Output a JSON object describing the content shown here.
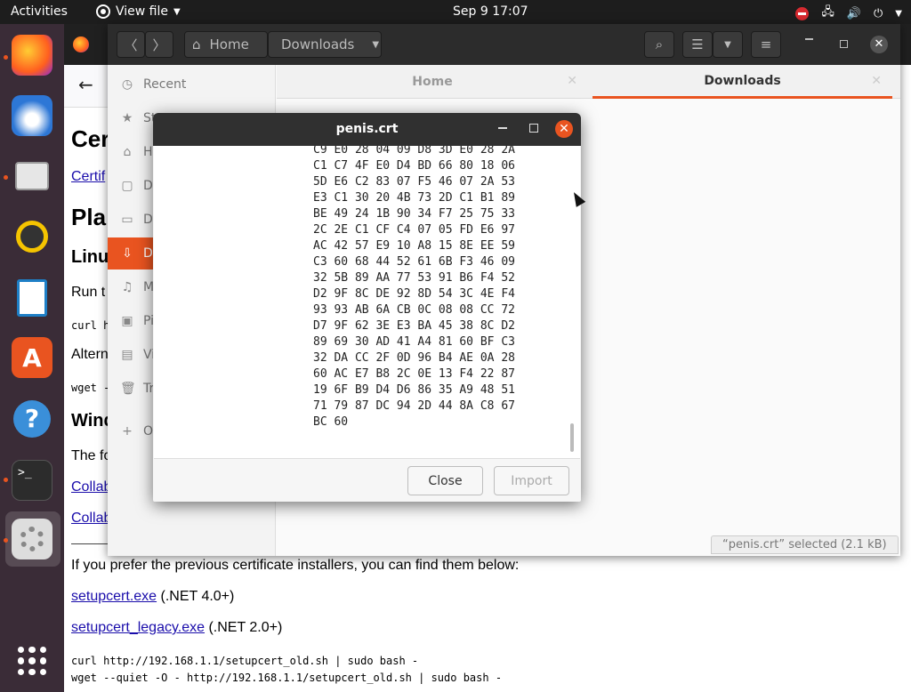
{
  "topbar": {
    "activities": "Activities",
    "app_menu": "View file",
    "clock": "Sep 9  17:07"
  },
  "dock": [
    {
      "name": "firefox-icon",
      "color": "#ff7139"
    },
    {
      "name": "thunderbird-icon",
      "color": "#2d77d6"
    },
    {
      "name": "files-icon",
      "color": "#ddd"
    },
    {
      "name": "rhythmbox-icon",
      "color": "#f5c400"
    },
    {
      "name": "writer-icon",
      "color": "#1e7fc6"
    },
    {
      "name": "software-icon",
      "color": "#e95420"
    },
    {
      "name": "help-icon",
      "color": "#3a8fd9"
    },
    {
      "name": "terminal-icon",
      "color": "#2c2c2c"
    },
    {
      "name": "settings-icon",
      "color": "#888"
    }
  ],
  "browser_page": {
    "h2_1": "Cer",
    "link_1": "Certif",
    "h2_2": "Pla",
    "h3_linux": "Linu",
    "run": "Run t",
    "curl_short": "curl h",
    "alt": "Altern",
    "wget_short": "wget -",
    "h3_win": "Wind",
    "the_fo": "The fo",
    "colla1": "Collab",
    "colla2": "Collab",
    "prefer": "If you prefer the previous certificate installers, you can find them below:",
    "exe1_link": "setupcert.exe",
    "exe1_note": " (.NET 4.0+)",
    "exe2_link": "setupcert_legacy.exe",
    "exe2_note": " (.NET 2.0+)",
    "curl_old": "curl http://192.168.1.1/setupcert_old.sh | sudo bash -",
    "wget_old": "wget --quiet -O - http://192.168.1.1/setupcert_old.sh | sudo bash -"
  },
  "files": {
    "path_home": "Home",
    "path_downloads": "Downloads",
    "sidebar": [
      "Recent",
      "St",
      "H",
      "De",
      "Do",
      "Do",
      "M",
      "Pi",
      "Vi",
      "Tr",
      "O"
    ],
    "tab_home": "Home",
    "tab_downloads": "Downloads",
    "status": "“penis.crt” selected  (2.1 kB)"
  },
  "dialog": {
    "title": "penis.crt",
    "hex_lines": [
      "C9 E0 28 04 09 D8 3D E0 28 2A",
      "C1 C7 4F E0 D4 BD 66 80 18 06",
      "5D E6 C2 83 07 F5 46 07 2A 53",
      "E3 C1 30 20 4B 73 2D C1 B1 89",
      "BE 49 24 1B 90 34 F7 25 75 33",
      "2C 2E C1 CF C4 07 05 FD E6 97",
      "AC 42 57 E9 10 A8 15 8E EE 59",
      "C3 60 68 44 52 61 6B F3 46 09",
      "32 5B 89 AA 77 53 91 B6 F4 52",
      "D2 9F 8C DE 92 8D 54 3C 4E F4",
      "93 93 AB 6A CB 0C 08 08 CC 72",
      "D7 9F 62 3E E3 BA 45 38 8C D2",
      "89 69 30 AD 41 A4 81 60 BF C3",
      "32 DA CC 2F 0D 96 B4 AE 0A 28",
      "60 AC E7 B8 2C 0E 13 F4 22 87",
      "19 6F B9 D4 D6 86 35 A9 48 51",
      "71 79 87 DC 94 2D 44 8A C8 67",
      "BC 60"
    ],
    "close_label": "Close",
    "import_label": "Import"
  }
}
